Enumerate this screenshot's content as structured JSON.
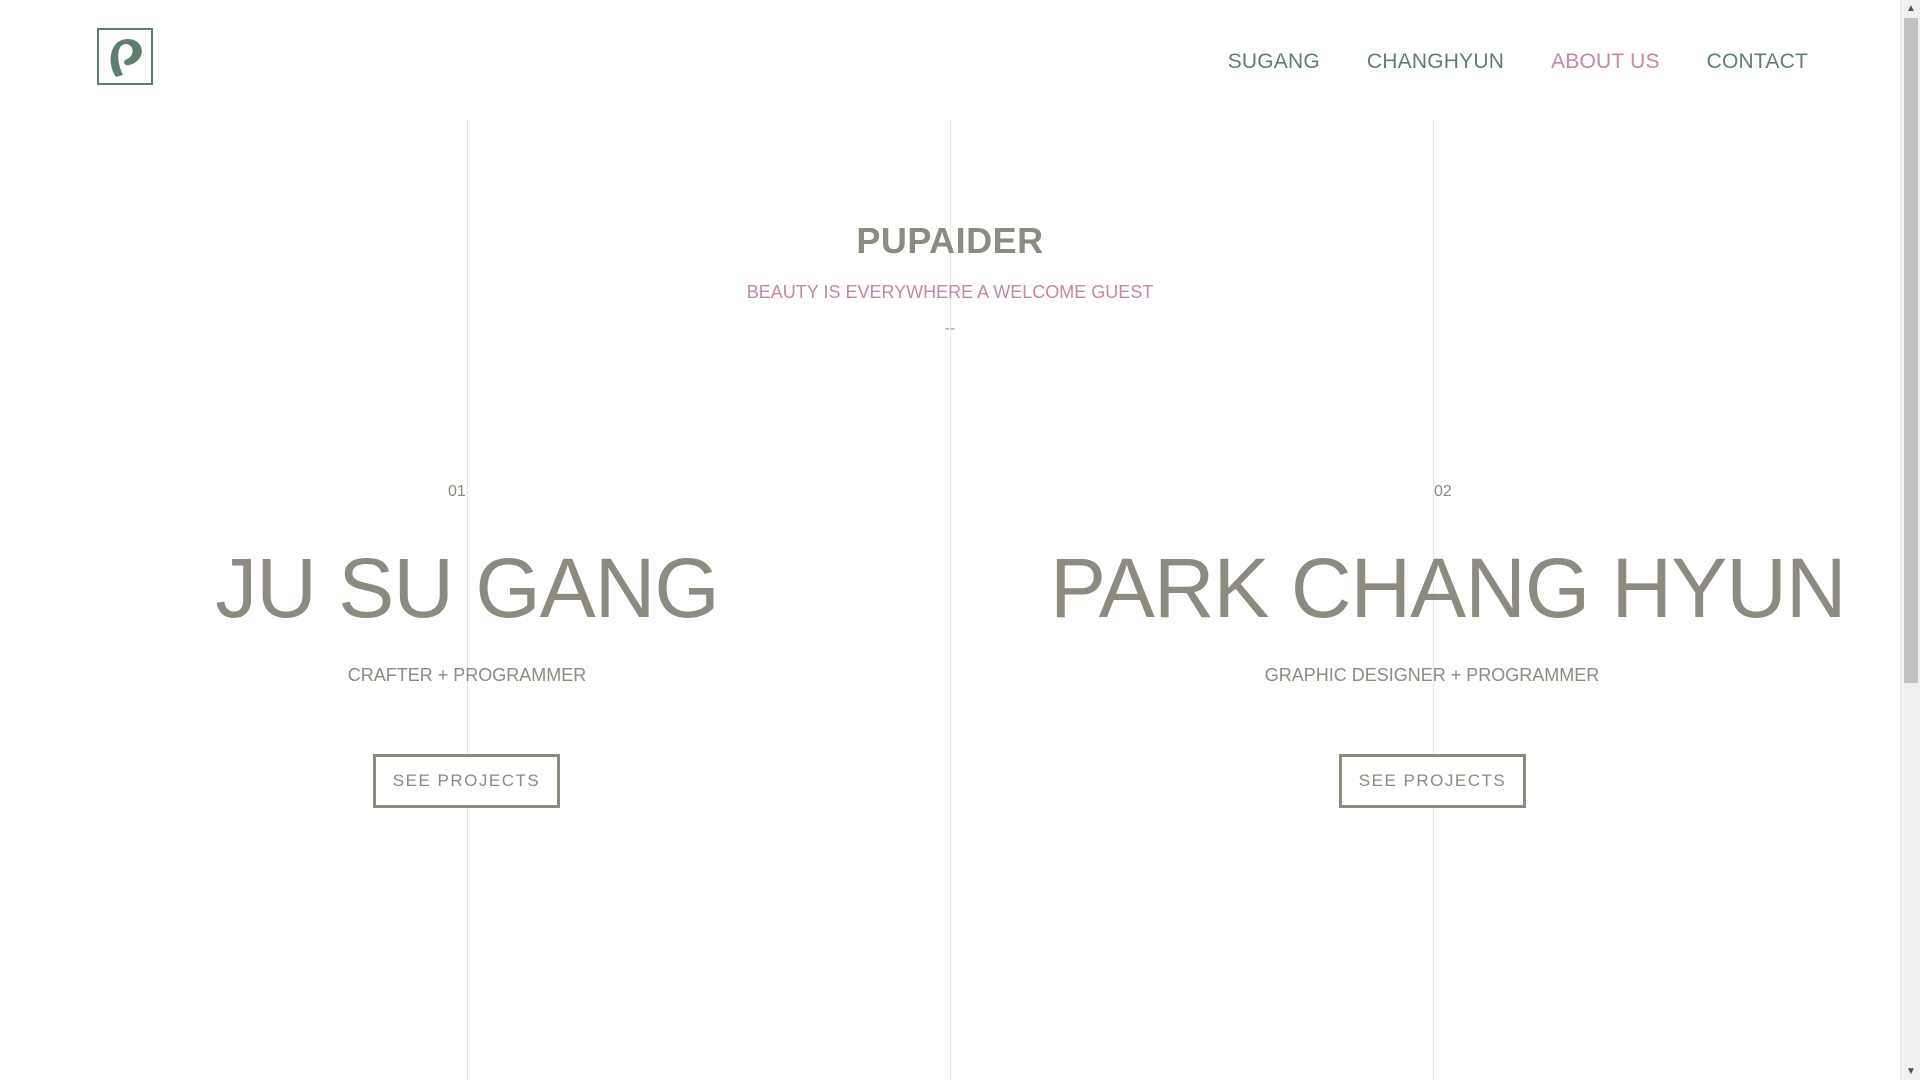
{
  "header": {
    "logo_icon": "leaf-p-logo-icon",
    "nav": [
      {
        "label": "SUGANG",
        "active": false
      },
      {
        "label": "CHANGHYUN",
        "active": false
      },
      {
        "label": "ABOUT US",
        "active": true
      },
      {
        "label": "CONTACT",
        "active": false
      }
    ]
  },
  "hero": {
    "title": "PUPAIDER",
    "subtitle": "BEAUTY IS EVERYWHERE A WELCOME GUEST",
    "divider": "--"
  },
  "profiles": [
    {
      "number": "01",
      "name": "JU SU GANG",
      "role": "CRAFTER + PROGRAMMER",
      "button_label": "SEE PROJECTS"
    },
    {
      "number": "02",
      "name": "PARK CHANG HYUN",
      "role": "GRAPHIC DESIGNER + PROGRAMMER",
      "button_label": "SEE PROJECTS"
    }
  ],
  "colors": {
    "green_accent": "#5c8070",
    "pink_accent": "#c48a96",
    "text_gray": "#8d8a7f"
  }
}
